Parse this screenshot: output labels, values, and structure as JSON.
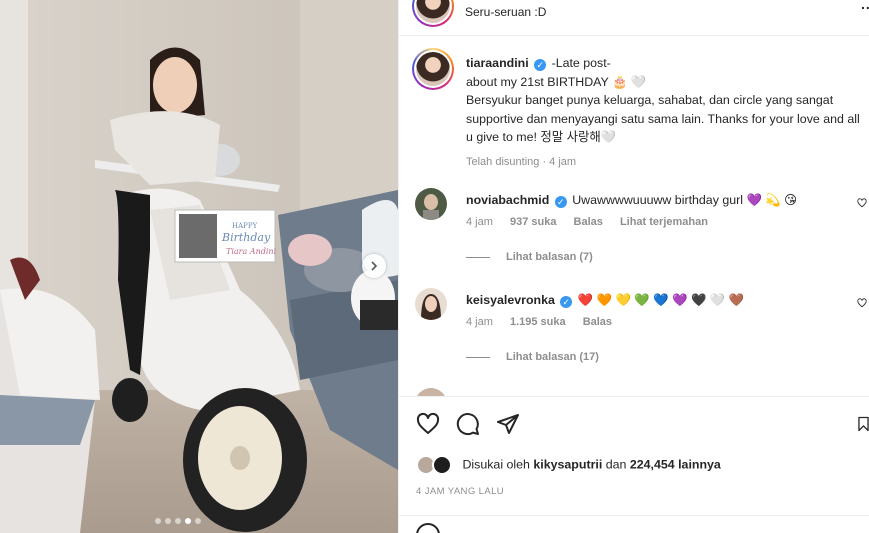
{
  "post": {
    "location": "Seru-seruan :D",
    "more_label": "...",
    "author": "tiaraandini",
    "caption_lines": [
      "-Late post-",
      "about my 21st BIRTHDAY 🎂 🤍",
      "Bersyukur banget punya keluarga, sahabat, dan circle yang sangat supportive dan menyayangi satu sama lain. Thanks for your love and all u give to me! 정말 사랑해🤍"
    ],
    "caption_meta": "Telah disunting · 4 jam",
    "verified_icon": "✓"
  },
  "photo": {
    "card_lines": [
      "HAPPY",
      "Birthday",
      "Tiara Andini"
    ],
    "carousel_count": 5,
    "carousel_active": 3
  },
  "comments": [
    {
      "user": "noviabachmid",
      "text": "Uwawwwwuuuww birthday gurl 💜 💫 😘",
      "time": "4 jam",
      "likes": "937 suka",
      "reply": "Balas",
      "translate": "Lihat terjemahan",
      "replies": "Lihat balasan (7)"
    },
    {
      "user": "keisyalevronka",
      "text": "❤️ 🧡 💛 💚 💙 💜 🖤 🤍 🤎",
      "time": "4 jam",
      "likes": "1.195 suka",
      "reply": "Balas",
      "replies": "Lihat balasan (17)"
    }
  ],
  "footer": {
    "liked_prefix": "Disukai oleh",
    "liked_user": "kikysaputrii",
    "liked_mid": "dan",
    "liked_count": "224,454 lainnya",
    "timestamp": "4 JAM YANG LALU"
  },
  "colors": {
    "verified": "#3897f0",
    "muted": "#8e8e8e",
    "text": "#262626"
  }
}
